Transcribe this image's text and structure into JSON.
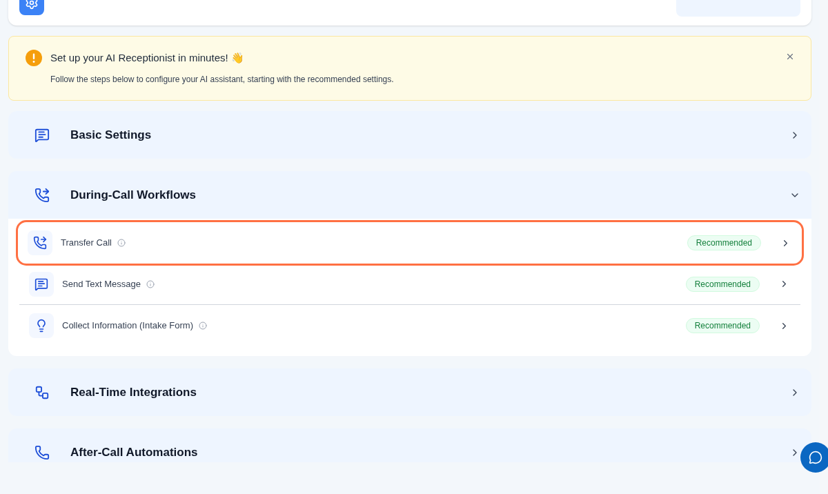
{
  "alert": {
    "title": "Set up your AI Receptionist in minutes! 👋",
    "message": "Follow the steps below to configure your AI assistant, starting with the recommended settings."
  },
  "sections": [
    {
      "title": "Basic Settings",
      "expanded": false
    },
    {
      "title": "During-Call Workflows",
      "expanded": true,
      "items": [
        {
          "label": "Transfer Call",
          "badge": "Recommended",
          "highlighted": true
        },
        {
          "label": "Send Text Message",
          "badge": "Recommended",
          "highlighted": false
        },
        {
          "label": "Collect Information (Intake Form)",
          "badge": "Recommended",
          "highlighted": false
        }
      ]
    },
    {
      "title": "Real-Time Integrations",
      "expanded": false
    },
    {
      "title": "After-Call Automations",
      "expanded": false
    }
  ]
}
